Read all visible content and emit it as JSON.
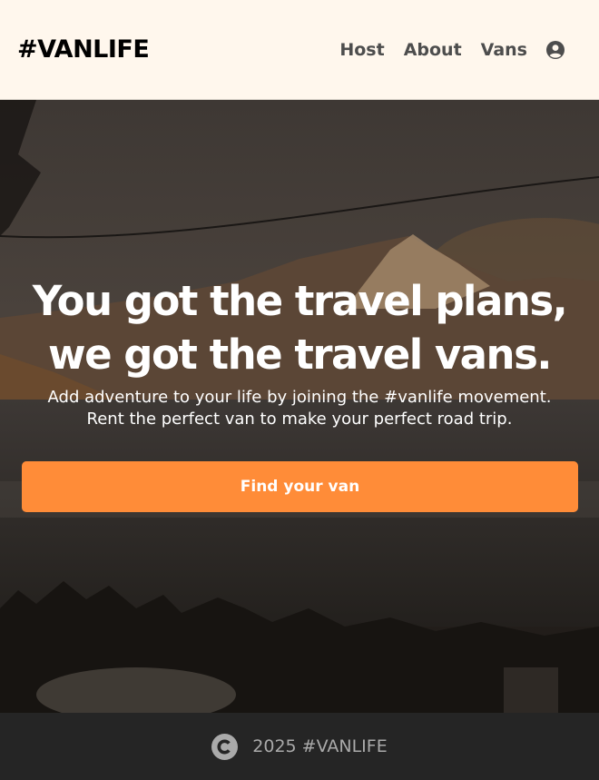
{
  "header": {
    "logo": "#VANLIFE",
    "nav": [
      {
        "label": "Host"
      },
      {
        "label": "About"
      },
      {
        "label": "Vans"
      }
    ],
    "account_icon": "user-circle-icon"
  },
  "hero": {
    "headline_line1": "You got the travel plans,",
    "headline_line2": "we got the travel vans.",
    "subtitle_line1": "Add adventure to your life by joining the #vanlife movement.",
    "subtitle_line2": "Rent the perfect van to make your perfect road trip.",
    "cta_label": "Find your van"
  },
  "footer": {
    "copyright_icon": "copyright-icon",
    "text": "2025 #VANLIFE"
  },
  "colors": {
    "header_bg": "#fff7ed",
    "accent": "#ff8c38",
    "footer_bg": "#252525",
    "nav_text": "#4d4d4d"
  }
}
